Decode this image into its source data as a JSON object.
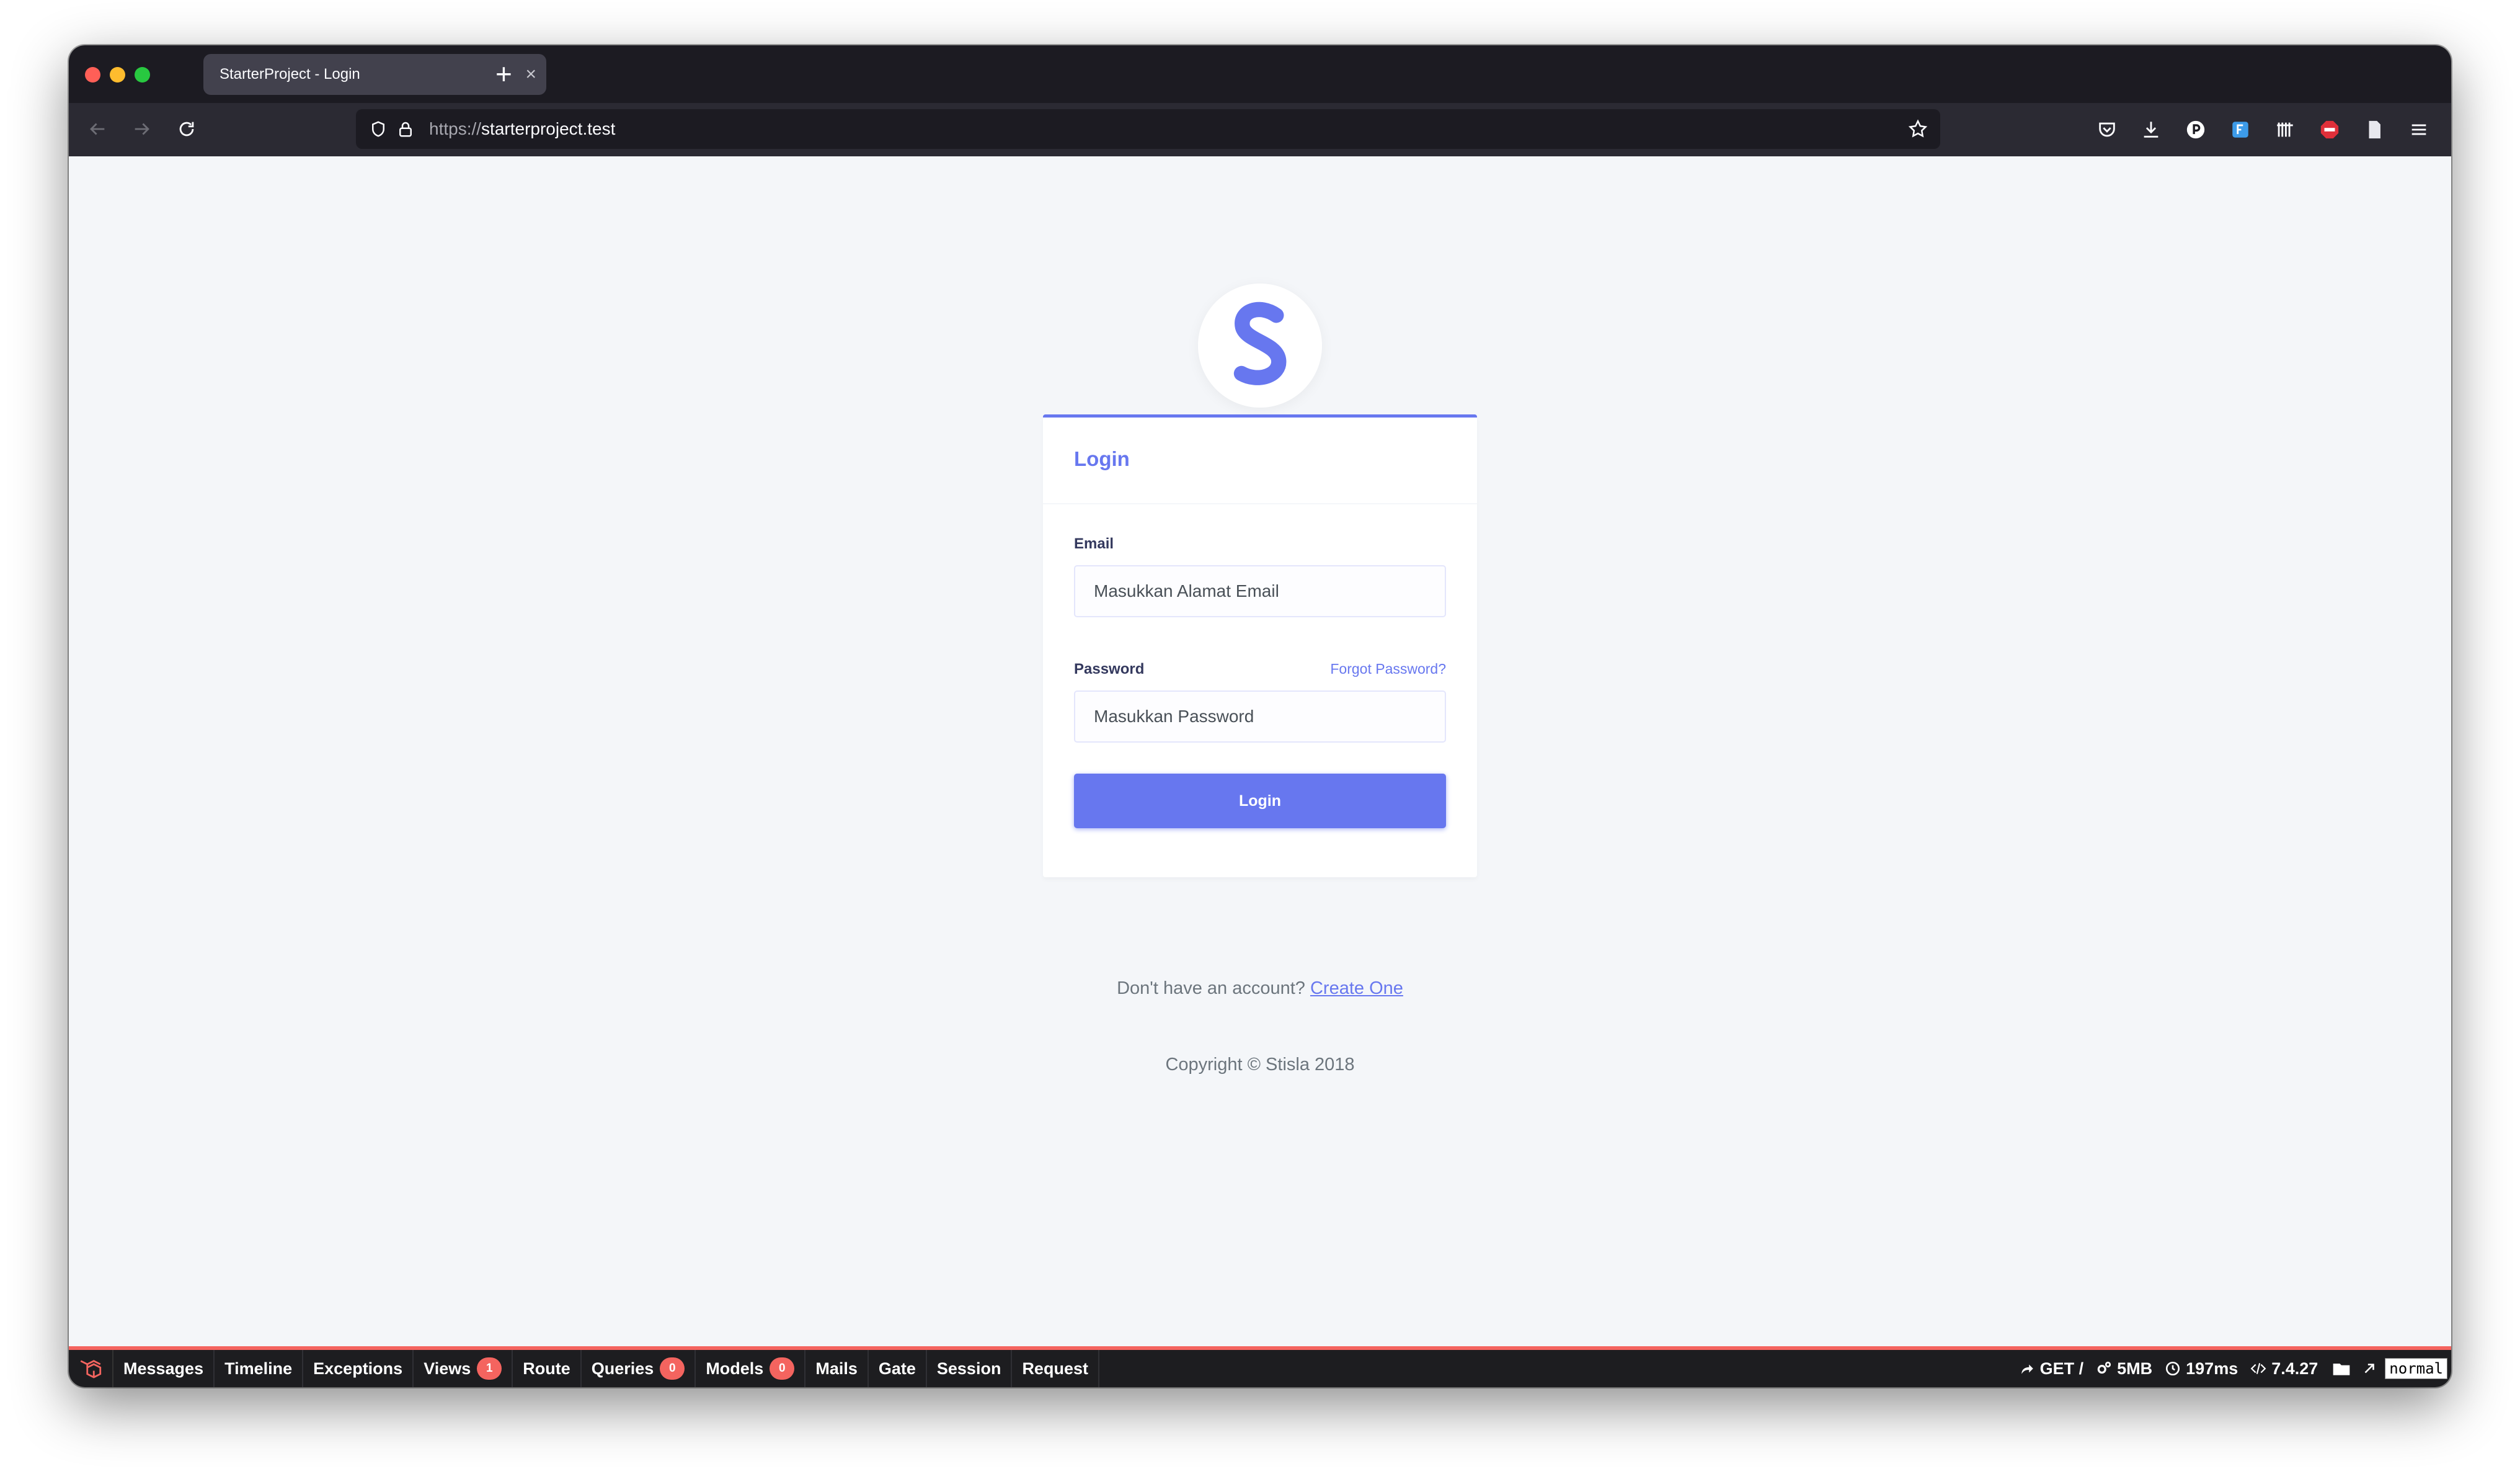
{
  "browser": {
    "tab_title": "StarterProject - Login",
    "tab_close": "×",
    "new_tab": "+",
    "url_protocol": "https://",
    "url_host": "starterproject.test"
  },
  "login": {
    "card_title": "Login",
    "email_label": "Email",
    "email_placeholder": "Masukkan Alamat Email",
    "password_label": "Password",
    "forgot_link": "Forgot Password?",
    "password_placeholder": "Masukkan Password",
    "submit_label": "Login"
  },
  "footer": {
    "signup_prompt": "Don't have an account?",
    "signup_link": "Create One",
    "copyright": "Copyright © Stisla 2018"
  },
  "debugbar": {
    "tabs": [
      {
        "label": "Messages",
        "badge": null
      },
      {
        "label": "Timeline",
        "badge": null
      },
      {
        "label": "Exceptions",
        "badge": null
      },
      {
        "label": "Views",
        "badge": "1"
      },
      {
        "label": "Route",
        "badge": null
      },
      {
        "label": "Queries",
        "badge": "0"
      },
      {
        "label": "Models",
        "badge": "0"
      },
      {
        "label": "Mails",
        "badge": null
      },
      {
        "label": "Gate",
        "badge": null
      },
      {
        "label": "Session",
        "badge": null
      },
      {
        "label": "Request",
        "badge": null
      }
    ],
    "request": "GET /",
    "memory": "5MB",
    "duration": "197ms",
    "php_version": "7.4.27",
    "tooltip": "normal"
  },
  "colors": {
    "primary": "#6777ef",
    "debugbar_accent": "#f4645f"
  }
}
